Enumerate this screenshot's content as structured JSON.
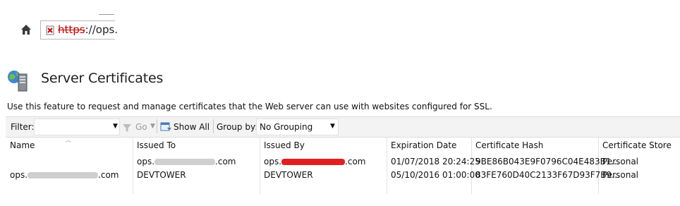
{
  "browser": {
    "url_scheme": "https",
    "url_rest": "://ops."
  },
  "header": {
    "title": "Server Certificates",
    "description": "Use this feature to request and manage certificates that the Web server can use with websites configured for SSL."
  },
  "toolbar": {
    "filter_label": "Filter:",
    "filter_value": "",
    "go_label": "Go",
    "show_all_label": "Show All",
    "group_by_label": "Group by:",
    "group_by_value": "No Grouping"
  },
  "table": {
    "columns": [
      "Name",
      "Issued To",
      "Issued By",
      "Expiration Date",
      "Certificate Hash",
      "Certificate Store"
    ],
    "rows": [
      {
        "name_prefix": "",
        "name_suffix": "",
        "issued_to_prefix": "ops.",
        "issued_to_suffix": ".com",
        "issued_by_prefix": "ops.",
        "issued_by_suffix": ".com",
        "expiration": "01/07/2018 20:24:25",
        "hash": "9BE86B043E9F0796C04E483B1...",
        "store": "Personal"
      },
      {
        "name_prefix": "ops.",
        "name_suffix": ".com",
        "issued_to": "DEVTOWER",
        "issued_by": "DEVTOWER",
        "expiration": "05/10/2016 01:00:00",
        "hash": "83FE760D40C2133F67D93F7B9...",
        "store": "Personal"
      }
    ]
  },
  "icons": {
    "home": "home-icon",
    "lock": "certificate-error-icon",
    "server": "server-certificate-icon",
    "funnel": "funnel-icon",
    "show_all": "show-all-icon"
  },
  "colors": {
    "error_red": "#c00000",
    "redaction_red": "#e02020"
  }
}
